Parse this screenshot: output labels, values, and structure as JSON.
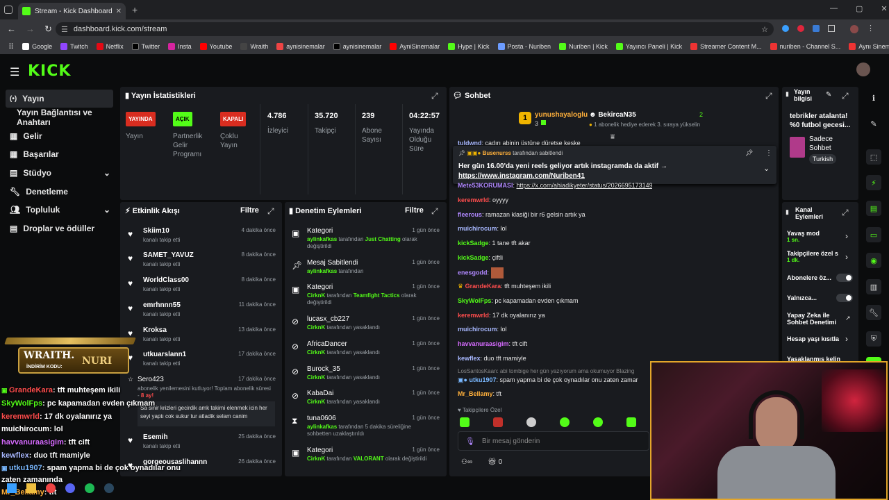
{
  "browser": {
    "tab_title": "Stream - Kick Dashboard",
    "url": "dashboard.kick.com/stream",
    "bookmarks": [
      "Google",
      "Twitch",
      "Netflix",
      "Twitter",
      "Insta",
      "Youtube",
      "Wraith",
      "aynisinemalar",
      "aynisinemalar",
      "AyniSinemalar",
      "Hype | Kick",
      "Posta - Nuriben",
      "Nuriben | Kick",
      "Yayıncı Paneli | Kick",
      "Streamer Content M...",
      "nuriben - Channel S...",
      "Aynı Sinemalar - Ça..."
    ]
  },
  "sidebar": {
    "items": [
      "Yayın",
      "Yayın Bağlantısı ve Anahtarı",
      "Gelir",
      "Başarılar",
      "Stüdyo",
      "Denetleme",
      "Topluluk",
      "Droplar ve ödüller"
    ]
  },
  "stats": {
    "title": "Yayın İstatistikleri",
    "badges": [
      {
        "badge": "YAYINDA",
        "label": "Yayın",
        "color": "#d92d20"
      },
      {
        "badge": "AÇIK",
        "label": "Partnerlik Gelir Programı",
        "color": "#53fc18"
      },
      {
        "badge": "KAPALI",
        "label": "Çoklu Yayın",
        "color": "#d92d20"
      }
    ],
    "values": [
      {
        "value": "4.786",
        "label": "İzleyici"
      },
      {
        "value": "35.720",
        "label": "Takipçi"
      },
      {
        "value": "239",
        "label": "Abone Sayısı"
      },
      {
        "value": "04:22:57",
        "label": "Yayında Olduğu Süre"
      }
    ]
  },
  "activity": {
    "title": "Etkinlik Akışı",
    "filter": "Filtre",
    "events": [
      {
        "name": "Skiim10",
        "sub": "kanalı takip etti",
        "time": "4 dakika önce"
      },
      {
        "name": "SAMET_YAVUZ",
        "sub": "kanalı takip etti",
        "time": "8 dakika önce"
      },
      {
        "name": "WorldClass00",
        "sub": "kanalı takip etti",
        "time": "8 dakika önce"
      },
      {
        "name": "emrhnnn55",
        "sub": "kanalı takip etti",
        "time": "11 dakika önce"
      },
      {
        "name": "Kroksa",
        "sub": "kanalı takip etti",
        "time": "13 dakika önce"
      },
      {
        "name": "utkuarslann1",
        "sub": "kanalı takip etti",
        "time": "17 dakika önce"
      }
    ],
    "resub": {
      "name": "Sero423",
      "time": "17 dakika önce",
      "text": "abonelik yenilemesini kutluyor! Toplam abonelik süresi -",
      "months": "8 ay!",
      "message": "Sa sinir krizleri gecirdik amk takimi elenmek icin her seyi yaptı cok sukur tur atladik selam canim"
    },
    "events2": [
      {
        "name": "Esemih",
        "sub": "kanalı takip etti",
        "time": "25 dakika önce"
      },
      {
        "name": "gorgeousaslihannn",
        "sub": "",
        "time": "26 dakika önce"
      }
    ]
  },
  "moderation": {
    "title": "Denetim Eylemleri",
    "filter": "Filtre",
    "actions": [
      {
        "title": "Kategori",
        "user": "aylinkafkas",
        "text": "tarafından",
        "target": "Just Chatting",
        "tail": "olarak değiştirildi",
        "time": "1 gün önce"
      },
      {
        "title": "Mesaj Sabitlendi",
        "user": "aylinkafkas",
        "text": "tarafından",
        "target": "",
        "tail": "",
        "time": "1 gün önce"
      },
      {
        "title": "Kategori",
        "user": "CirknK",
        "text": "tarafından",
        "target": "Teamfight Tactics",
        "tail": "olarak değiştirildi",
        "time": "1 gün önce"
      },
      {
        "title": "lucasx_cb227",
        "user": "CirknK",
        "text": "tarafından yasaklandı",
        "target": "",
        "tail": "",
        "time": "1 gün önce"
      },
      {
        "title": "AfricaDancer",
        "user": "CirknK",
        "text": "tarafından yasaklandı",
        "target": "",
        "tail": "",
        "time": "1 gün önce"
      },
      {
        "title": "Burock_35",
        "user": "CirknK",
        "text": "tarafından yasaklandı",
        "target": "",
        "tail": "",
        "time": "1 gün önce"
      },
      {
        "title": "KabaDai",
        "user": "CirknK",
        "text": "tarafından yasaklandı",
        "target": "",
        "tail": "",
        "time": "1 gün önce"
      },
      {
        "title": "tuna0606",
        "user": "aylinkafkas",
        "text": "tarafından 5 dakika süreliğine sohbetten uzaklaştırıldı",
        "target": "",
        "tail": "",
        "time": "1 gün önce"
      },
      {
        "title": "Kategori",
        "user": "CirknK",
        "text": "tarafından",
        "target": "VALORANT",
        "tail": "olarak değiştirildi",
        "time": "1 gün önce"
      }
    ]
  },
  "chat": {
    "title": "Sohbet",
    "top_gifter": {
      "name": "yunushayaloglu",
      "count": "3"
    },
    "gift_user": "BekircaN35",
    "gift_count": "2",
    "gift_text": "1 abonelik hediye ederek 3. sıraya yükselin",
    "pinned_by": "Busenurss",
    "pinned_by_text": "tarafından sabitlendi",
    "pinned_text": "Her gün 16.00'da yeni reels geliyor artık instagramda da aktif →",
    "pinned_link": "https://www.instagram.com/Nuriben41",
    "partial_top": "cadırı abinin üstüne düretse keske",
    "partial_top_user": "tuldwnd",
    "messages": [
      {
        "user": "Mete53KORUMASI",
        "color": "#b088ff",
        "text": "https://x.com/ahiadikyeter/status/2026695173149741209"
      },
      {
        "user": "keremwrld",
        "color": "#ff4d4d",
        "text": "oyyyy"
      },
      {
        "user": "fleerous",
        "color": "#b088ff",
        "text": "ramazan klasiği bir r6 gelsin artık ya"
      },
      {
        "user": "muichirocum",
        "color": "#a8b8ff",
        "text": "lol"
      },
      {
        "user": "kickSadge",
        "color": "#53fc18",
        "text": "1 tane tft akar"
      },
      {
        "user": "kickSadge",
        "color": "#53fc18",
        "text": "çiftli"
      },
      {
        "user": "enesgodd",
        "color": "#b088ff",
        "text": ""
      },
      {
        "user": "GrandeKara",
        "color": "#ff4d4d",
        "text": "tft muhteşem ikili"
      },
      {
        "user": "SkyWolFps",
        "color": "#53fc18",
        "text": "pc kapamadan evden çıkmam"
      },
      {
        "user": "keremwrld",
        "color": "#ff4d4d",
        "text": "17 dk oyalanırız ya"
      },
      {
        "user": "muichirocum",
        "color": "#a8b8ff",
        "text": "lol"
      },
      {
        "user": "havvanuraasigim",
        "color": "#d66bff",
        "text": "tft cift"
      },
      {
        "user": "kewflex",
        "color": "#a8b8ff",
        "text": "duo tft mamiyle"
      }
    ],
    "reply_hint": "LosSantosKaan: abi tombige her gün yazıyorum ama okumuyor Blazing",
    "reply_user": "utku1907",
    "reply_text": "spam yapma bi de çok oynadılar onu zaten zamar",
    "last_user": "Mr_Bellamy",
    "last_text": "tft",
    "followers_only": "Takipçilere Özel",
    "input_placeholder": "Bir mesaj gönderin",
    "footer_count": "0"
  },
  "stream_info": {
    "title": "Yayın bilgisi",
    "stream_title": "tebrikler atalanta! %0 futbol gecesi...",
    "category": "Sadece Sohbet",
    "language": "Turkish"
  },
  "channel_actions": {
    "title": "Kanal Eylemleri",
    "items": [
      {
        "label": "Yavaş mod",
        "sub": "1 sn."
      },
      {
        "label": "Takipçilere özel s",
        "sub": "1 dk."
      },
      {
        "label": "Abonelere öz...",
        "sub": ""
      },
      {
        "label": "Yalnızca...",
        "sub": ""
      },
      {
        "label": "Yapay Zeka ile Sohbet Denetimi",
        "sub": ""
      },
      {
        "label": "Hesap yaşı kısıtla",
        "sub": ""
      },
      {
        "label": "Yasaklanmış kelin",
        "sub": ""
      }
    ]
  },
  "overlay": {
    "brand": "WRAITH.",
    "brand2": "NURI",
    "code_label": "İNDİRİM KODU:",
    "lines": [
      {
        "user": "GrandeKara",
        "text": ": tft muhteşem ikili",
        "color": "#ff4d4d"
      },
      {
        "user": "SkyWolFps",
        "text": ": pc kapamadan evden çıkmam",
        "color": "#53fc18"
      },
      {
        "user": "keremwrld",
        "text": ": 17 dk oyalanırız ya",
        "color": "#ff4d4d"
      },
      {
        "user": "muichirocum",
        "text": ": lol",
        "color": "#ffffff"
      },
      {
        "user": "havvanuraasigim",
        "text": ": tft cift",
        "color": "#d66bff"
      },
      {
        "user": "kewflex",
        "text": ": duo tft mamiyle",
        "color": "#a8b8ff"
      },
      {
        "user": "utku1907",
        "text": ": spam yapma bi de çok oynadılar onu",
        "color": "#7ab8ff"
      },
      {
        "user": "zaten zamanında",
        "text": "",
        "color": "#ffffff"
      },
      {
        "user": "Mr_Bellamy",
        "text": ": tft",
        "color": "#ffb03b"
      }
    ]
  }
}
